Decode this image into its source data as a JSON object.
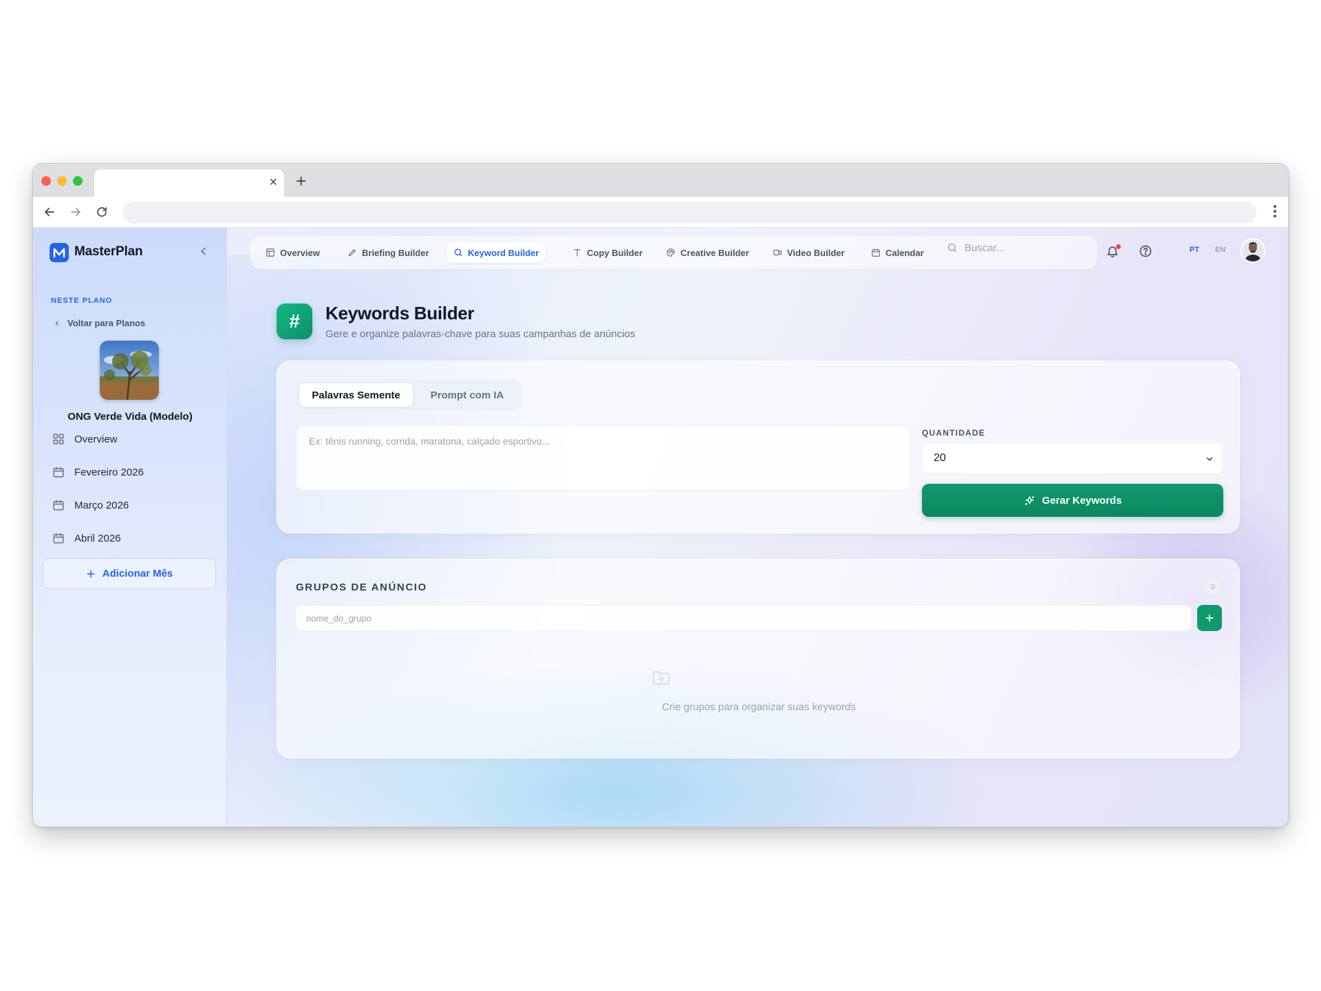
{
  "browser": {
    "tab_close": "×",
    "new_tab": "+"
  },
  "sidebar": {
    "brand": "MasterPlan",
    "section_label": "NESTE PLANO",
    "back_label": "Voltar para Planos",
    "org_name": "ONG Verde Vida (Modelo)",
    "items": [
      {
        "label": "Overview",
        "icon": "grid-icon"
      },
      {
        "label": "Fevereiro 2026",
        "icon": "calendar-icon"
      },
      {
        "label": "Março 2026",
        "icon": "calendar-icon"
      },
      {
        "label": "Abril 2026",
        "icon": "calendar-icon"
      }
    ],
    "add_month": "Adicionar Mês"
  },
  "topnav": {
    "items": [
      {
        "label": "Overview",
        "icon": "layout-icon"
      },
      {
        "label": "Briefing Builder",
        "icon": "pen-icon"
      },
      {
        "label": "Keyword Builder",
        "icon": "search-icon",
        "active": true
      },
      {
        "label": "Copy Builder",
        "icon": "text-icon"
      },
      {
        "label": "Creative Builder",
        "icon": "palette-icon"
      },
      {
        "label": "Video Builder",
        "icon": "video-icon"
      },
      {
        "label": "Calendar",
        "icon": "calendar-icon"
      }
    ],
    "search_placeholder": "Buscar...",
    "lang_pt": "PT",
    "lang_en": "EN"
  },
  "page": {
    "title": "Keywords Builder",
    "subtitle": "Gere e organize palavras-chave para suas campanhas de anúncios",
    "icon": "#"
  },
  "generator": {
    "tabs": [
      "Palavras Semente",
      "Prompt com IA"
    ],
    "seeds_placeholder": "Ex: tênis running, corrida, maratona, calçado esportivo...",
    "quantity_label": "QUANTIDADE",
    "quantity_value": "20",
    "generate_button": "Gerar Keywords"
  },
  "groups": {
    "title": "GRUPOS DE ANÚNCIO",
    "count": "0",
    "name_placeholder": "nome_do_grupo",
    "empty_text": "Crie grupos para organizar suas keywords"
  },
  "colors": {
    "accent": "#2563eb",
    "primary_green": "#0f9a6c"
  }
}
